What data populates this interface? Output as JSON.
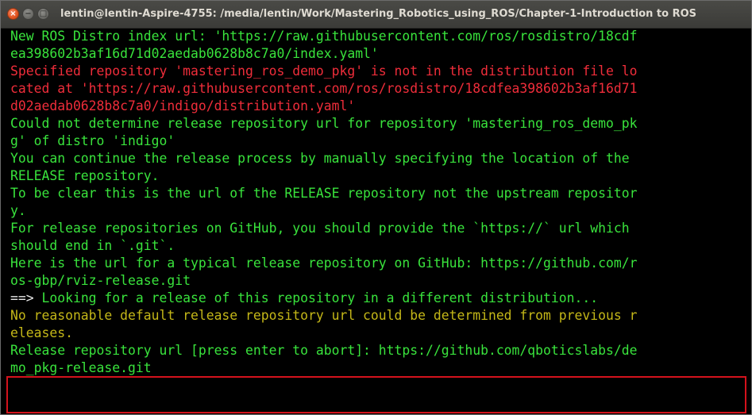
{
  "window": {
    "title": "lentin@lentin-Aspire-4755: /media/lentin/Work/Mastering_Robotics_using_ROS/Chapter-1-Introduction to ROS",
    "buttons": {
      "close": "×",
      "minimize": "−",
      "maximize": "□"
    }
  },
  "terminal": {
    "lines": [
      {
        "color": "green",
        "text": "New ROS Distro index url: 'https://raw.githubusercontent.com/ros/rosdistro/18cdf"
      },
      {
        "color": "green",
        "text": "ea398602b3af16d71d02aedab0628b8c7a0/index.yaml'"
      },
      {
        "color": "red",
        "text": "Specified repository 'mastering_ros_demo_pkg' is not in the distribution file lo"
      },
      {
        "color": "red",
        "text": "cated at 'https://raw.githubusercontent.com/ros/rosdistro/18cdfea398602b3af16d71"
      },
      {
        "color": "red",
        "text": "d02aedab0628b8c7a0/indigo/distribution.yaml'"
      },
      {
        "color": "green",
        "text": "Could not determine release repository url for repository 'mastering_ros_demo_pk"
      },
      {
        "color": "green",
        "text": "g' of distro 'indigo'"
      },
      {
        "color": "green",
        "text": "You can continue the release process by manually specifying the location of the"
      },
      {
        "color": "green",
        "text": "RELEASE repository."
      },
      {
        "color": "green",
        "text": "To be clear this is the url of the RELEASE repository not the upstream repositor"
      },
      {
        "color": "green",
        "text": "y."
      },
      {
        "color": "green",
        "text": "For release repositories on GitHub, you should provide the `https://` url which"
      },
      {
        "color": "green",
        "text": "should end in `.git`."
      },
      {
        "color": "green",
        "text": "Here is the url for a typical release repository on GitHub: https://github.com/r"
      },
      {
        "color": "green",
        "text": "os-gbp/rviz-release.git"
      },
      {
        "color": "mixed",
        "prefix": "==>",
        "text": " Looking for a release of this repository in a different distribution..."
      },
      {
        "color": "yellow",
        "text": "No reasonable default release repository url could be determined from previous r"
      },
      {
        "color": "yellow",
        "text": "eleases."
      },
      {
        "color": "green",
        "text": "Release repository url [press enter to abort]: https://github.com/qboticslabs/de"
      },
      {
        "color": "green",
        "text": "mo_pkg-release.git"
      }
    ]
  },
  "colors": {
    "background": "#000000",
    "green": "#39e33c",
    "red": "#ef2d3a",
    "yellow": "#c4b718",
    "highlight_border": "#d4121c"
  }
}
